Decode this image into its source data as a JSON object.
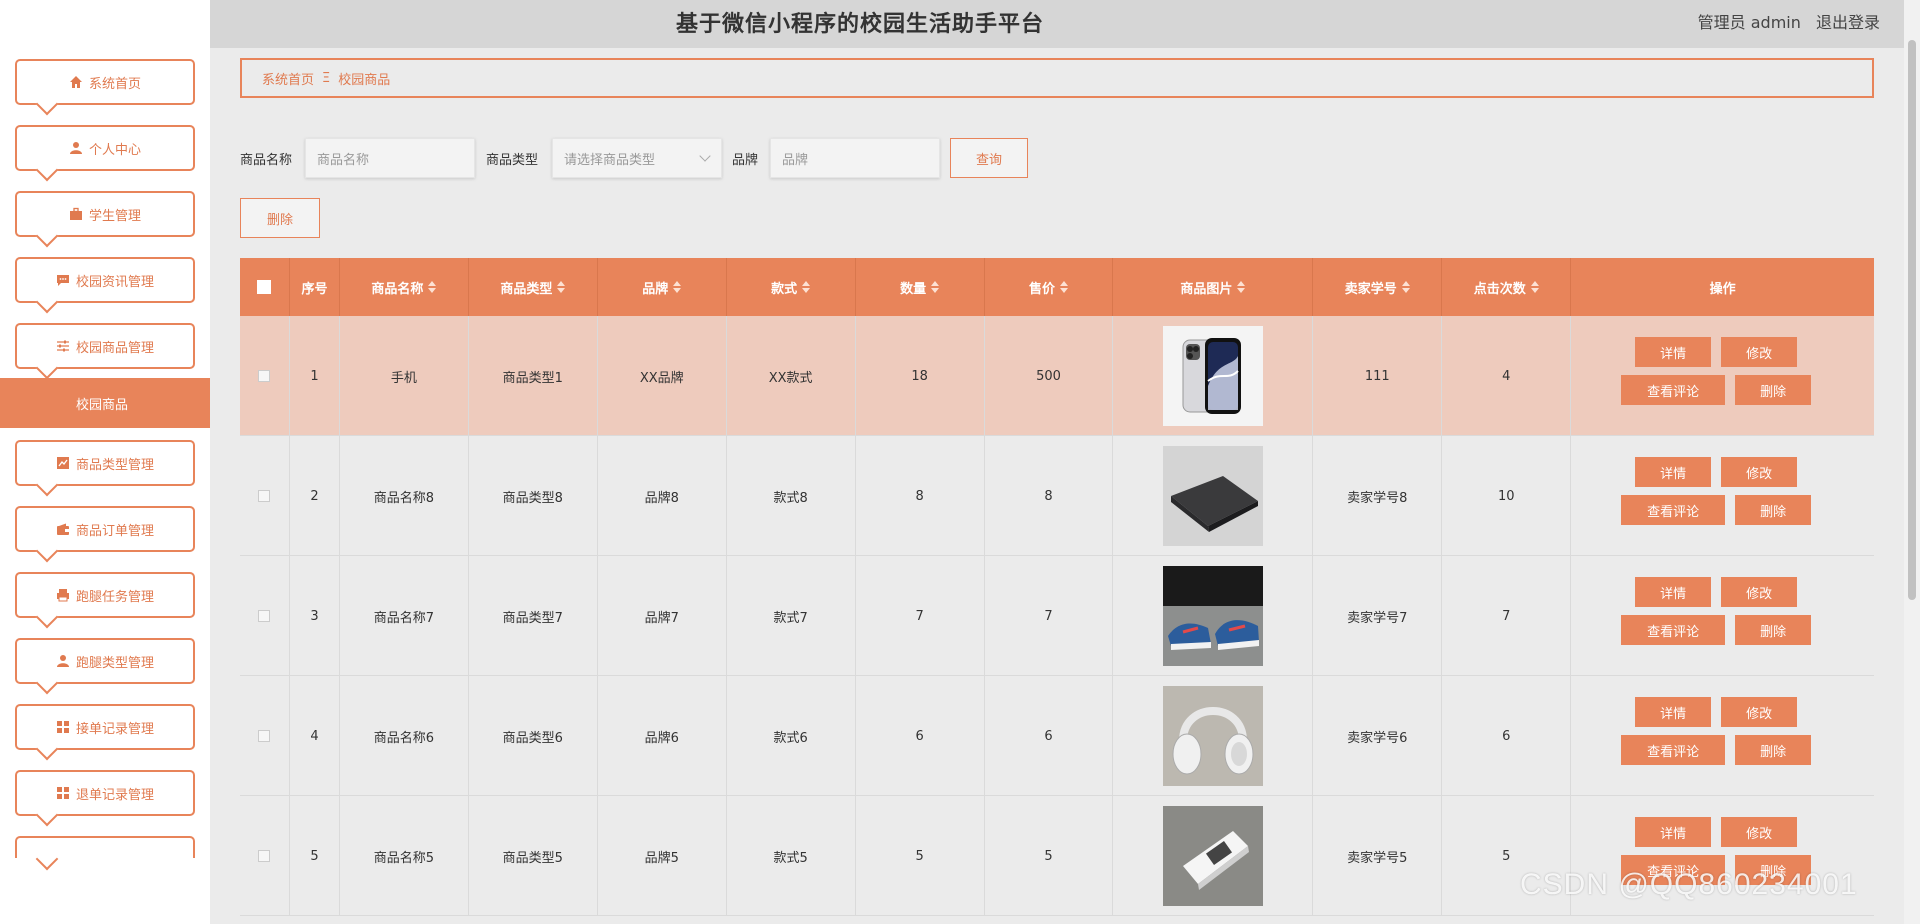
{
  "header": {
    "title": "基于微信小程序的校园生活助手平台",
    "user_label": "管理员 admin",
    "logout": "退出登录"
  },
  "sidebar": {
    "items": [
      {
        "label": "系统首页",
        "icon": "home-icon"
      },
      {
        "label": "个人中心",
        "icon": "user-icon"
      },
      {
        "label": "学生管理",
        "icon": "briefcase-icon"
      },
      {
        "label": "校园资讯管理",
        "icon": "chat-icon"
      },
      {
        "label": "校园商品管理",
        "icon": "sliders-icon"
      },
      {
        "label": "商品类型管理",
        "icon": "chart-icon"
      },
      {
        "label": "商品订单管理",
        "icon": "wallet-icon"
      },
      {
        "label": "跑腿任务管理",
        "icon": "printer-icon"
      },
      {
        "label": "跑腿类型管理",
        "icon": "user-icon"
      },
      {
        "label": "接单记录管理",
        "icon": "grid-icon"
      },
      {
        "label": "退单记录管理",
        "icon": "grid-icon"
      }
    ],
    "active_sub": "校园商品"
  },
  "breadcrumb": {
    "home": "系统首页",
    "separator": "Ξ",
    "current": "校园商品"
  },
  "search": {
    "name_label": "商品名称",
    "name_placeholder": "商品名称",
    "type_label": "商品类型",
    "type_placeholder": "请选择商品类型",
    "brand_label": "品牌",
    "brand_placeholder": "品牌",
    "query_button": "查询",
    "delete_button": "删除"
  },
  "table": {
    "columns": [
      "序号",
      "商品名称",
      "商品类型",
      "品牌",
      "款式",
      "数量",
      "售价",
      "商品图片",
      "卖家学号",
      "点击次数",
      "操作"
    ],
    "rows": [
      {
        "no": "1",
        "name": "手机",
        "type": "商品类型1",
        "brand": "XX品牌",
        "style": "XX款式",
        "qty": "18",
        "price": "500",
        "image": "smartphone",
        "seller": "111",
        "clicks": "4"
      },
      {
        "no": "2",
        "name": "商品名称8",
        "type": "商品类型8",
        "brand": "品牌8",
        "style": "款式8",
        "qty": "8",
        "price": "8",
        "image": "laptop",
        "seller": "卖家学号8",
        "clicks": "10"
      },
      {
        "no": "3",
        "name": "商品名称7",
        "type": "商品类型7",
        "brand": "品牌7",
        "style": "款式7",
        "qty": "7",
        "price": "7",
        "image": "sneakers",
        "seller": "卖家学号7",
        "clicks": "7"
      },
      {
        "no": "4",
        "name": "商品名称6",
        "type": "商品类型6",
        "brand": "品牌6",
        "style": "款式6",
        "qty": "6",
        "price": "6",
        "image": "headphones",
        "seller": "卖家学号6",
        "clicks": "6"
      },
      {
        "no": "5",
        "name": "商品名称5",
        "type": "商品类型5",
        "brand": "品牌5",
        "style": "款式5",
        "qty": "5",
        "price": "5",
        "image": "phone-stand",
        "seller": "卖家学号5",
        "clicks": "5"
      }
    ],
    "actions": {
      "detail": "详情",
      "edit": "修改",
      "comments": "查看评论",
      "delete": "删除"
    }
  },
  "colors": {
    "accent": "#e8845a",
    "highlight_row": "#eecbbd",
    "header_bg": "#d6d6d6",
    "page_bg": "#ebebeb"
  },
  "watermark": "CSDN @QQ860234001"
}
